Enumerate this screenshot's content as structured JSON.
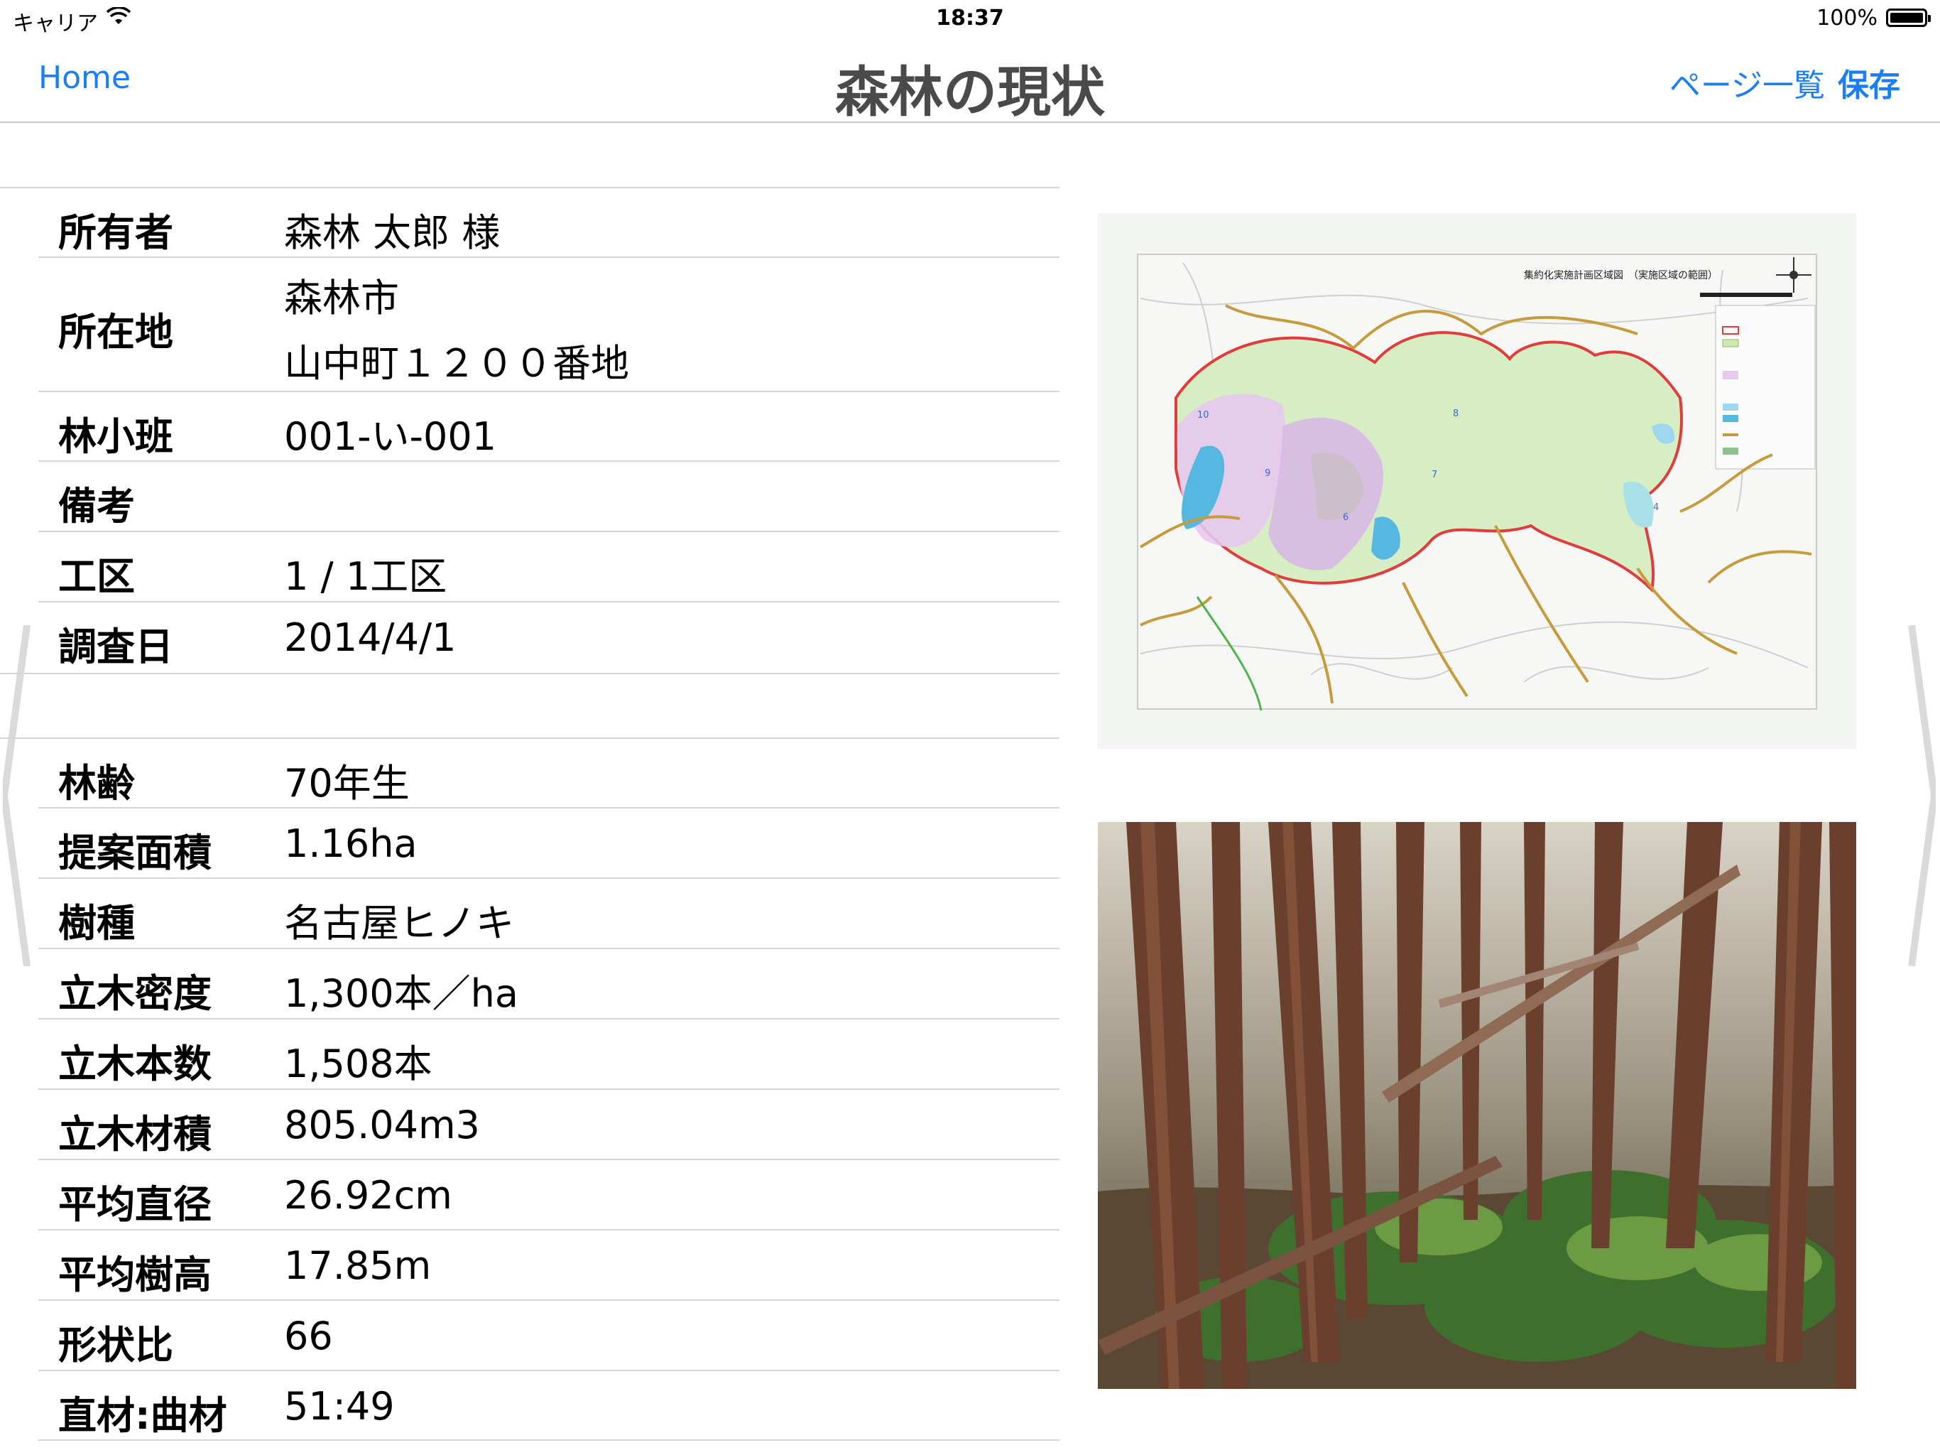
{
  "status_bar": {
    "carrier": "キャリア",
    "time": "18:37",
    "battery": "100%"
  },
  "nav": {
    "home": "Home",
    "title": "森林の現状",
    "pages": "ページ一覧",
    "save": "保存"
  },
  "rows": [
    {
      "label": "所有者",
      "value": "森林 太郎 様"
    },
    {
      "label": "所在地",
      "value": "森林市",
      "value2": "山中町１２００番地"
    },
    {
      "label": "林小班",
      "value": "001-い-001"
    },
    {
      "label": "備考",
      "value": ""
    },
    {
      "label": "工区",
      "value": "1 / 1工区"
    },
    {
      "label": "調査日",
      "value": "2014/4/1"
    },
    {
      "label": "林齢",
      "value": "70年生"
    },
    {
      "label": "提案面積",
      "value": "1.16ha"
    },
    {
      "label": "樹種",
      "value": "名古屋ヒノキ"
    },
    {
      "label": "立木密度",
      "value": "1,300本／ha"
    },
    {
      "label": "立木本数",
      "value": "1,508本"
    },
    {
      "label": "立木材積",
      "value": "805.04m3"
    },
    {
      "label": "平均直径",
      "value": "26.92cm"
    },
    {
      "label": "平均樹高",
      "value": "17.85m"
    },
    {
      "label": "形状比",
      "value": "66"
    },
    {
      "label": "直材:曲材",
      "value": "51:49"
    }
  ],
  "map": {
    "title": "集約化実施計画区域図　（実施区域の範囲）"
  }
}
